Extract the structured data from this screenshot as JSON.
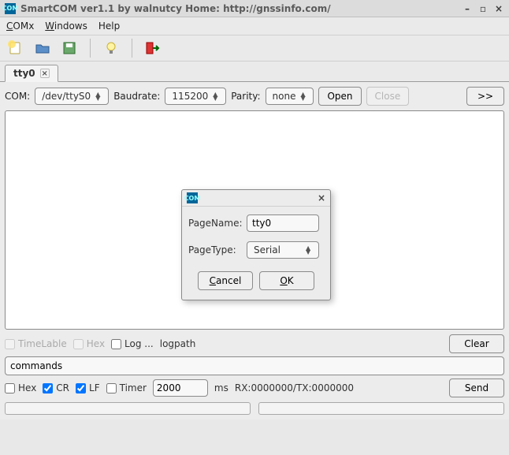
{
  "title": "SmartCOM ver1.1 by walnutcy  Home: http://gnssinfo.com/",
  "menubar": {
    "comx": "COMx",
    "windows": "Windows",
    "help": "Help"
  },
  "toolbar": {
    "icons": [
      "new-icon",
      "open-icon",
      "save-icon",
      "bulb-icon",
      "exit-icon"
    ]
  },
  "tab": {
    "label": "tty0"
  },
  "comrow": {
    "com_label": "COM:",
    "port": "/dev/ttyS0",
    "baud_label": "Baudrate:",
    "baudrate": "115200",
    "parity_label": "Parity:",
    "parity": "none",
    "open": "Open",
    "close": "Close",
    "more": ">>"
  },
  "logrow": {
    "timelabel": "TimeLable",
    "hex": "Hex",
    "log": "Log ...",
    "logpath": "logpath",
    "clear": "Clear"
  },
  "cmd": {
    "value": "commands"
  },
  "sendrow": {
    "hex": "Hex",
    "cr": "CR",
    "lf": "LF",
    "timer": "Timer",
    "timer_value": "2000",
    "ms_label": "ms",
    "rxtx": "RX:0000000/TX:0000000",
    "send": "Send"
  },
  "dialog": {
    "pagename_label": "PageName:",
    "pagename_value": "tty0",
    "pagetype_label": "PageType:",
    "pagetype_value": "Serial",
    "cancel": "Cancel",
    "ok": "OK"
  }
}
